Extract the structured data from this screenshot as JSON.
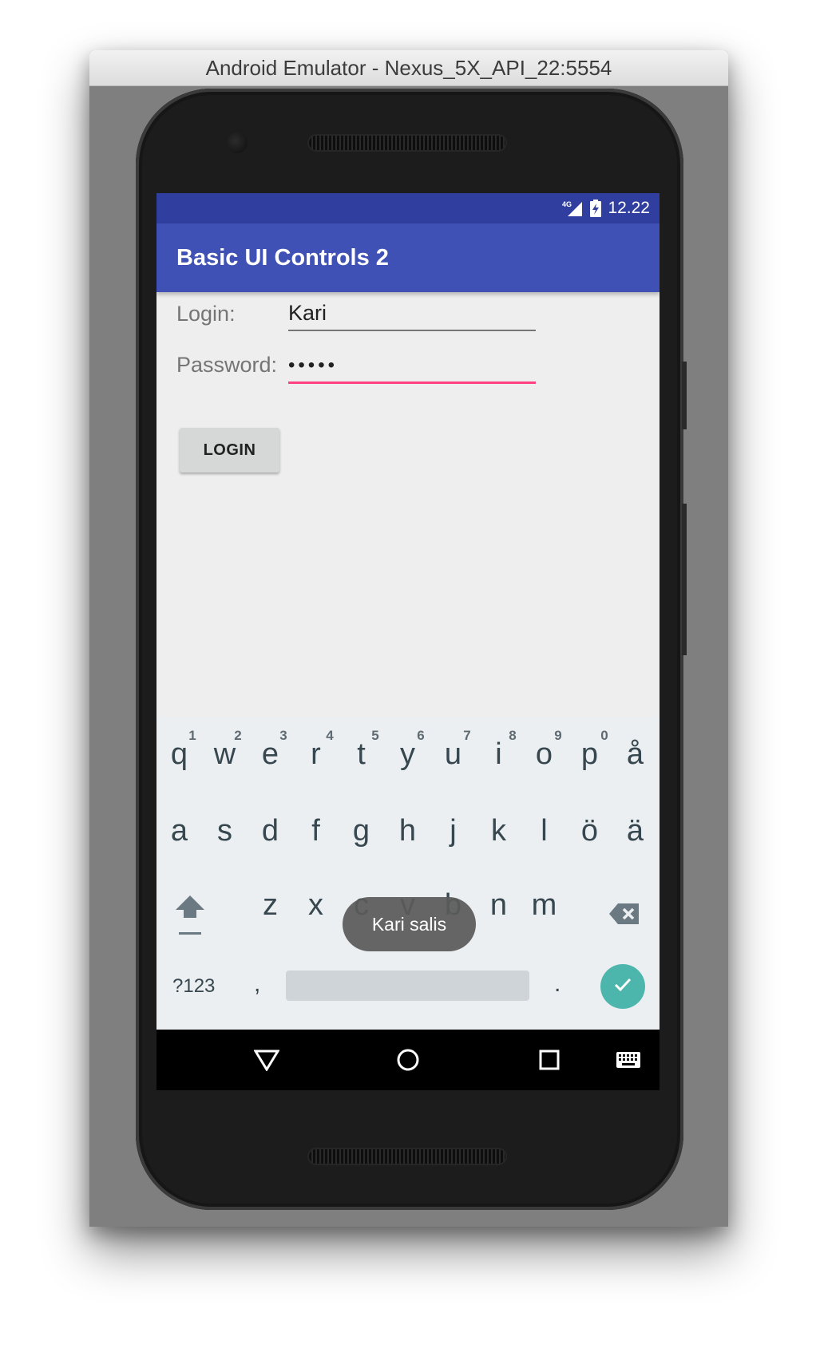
{
  "window": {
    "title": "Android Emulator - Nexus_5X_API_22:5554"
  },
  "statusbar": {
    "network": "4G",
    "time": "12.22"
  },
  "appbar": {
    "title": "Basic UI Controls 2"
  },
  "form": {
    "login_label": "Login:",
    "login_value": "Kari",
    "password_label": "Password:",
    "password_value": "•••••",
    "login_button": "LOGIN"
  },
  "keyboard": {
    "row1": [
      "q",
      "w",
      "e",
      "r",
      "t",
      "y",
      "u",
      "i",
      "o",
      "p",
      "å"
    ],
    "row1_hints": [
      "1",
      "2",
      "3",
      "4",
      "5",
      "6",
      "7",
      "8",
      "9",
      "0"
    ],
    "row2": [
      "a",
      "s",
      "d",
      "f",
      "g",
      "h",
      "j",
      "k",
      "l",
      "ö",
      "ä"
    ],
    "row3": [
      "z",
      "x",
      "c",
      "v",
      "b",
      "n",
      "m"
    ],
    "symbols_label": "?123",
    "comma": ",",
    "period": "."
  },
  "toast": {
    "text": "Kari salis"
  },
  "colors": {
    "primary": "#3f51b5",
    "primary_dark": "#303f9f",
    "accent": "#ff4081",
    "enter_key": "#4db6ac"
  },
  "icons": [
    "signal-icon",
    "battery-icon",
    "shift-icon",
    "backspace-icon",
    "check-icon",
    "back-icon",
    "home-icon",
    "recents-icon",
    "keyboard-icon"
  ]
}
